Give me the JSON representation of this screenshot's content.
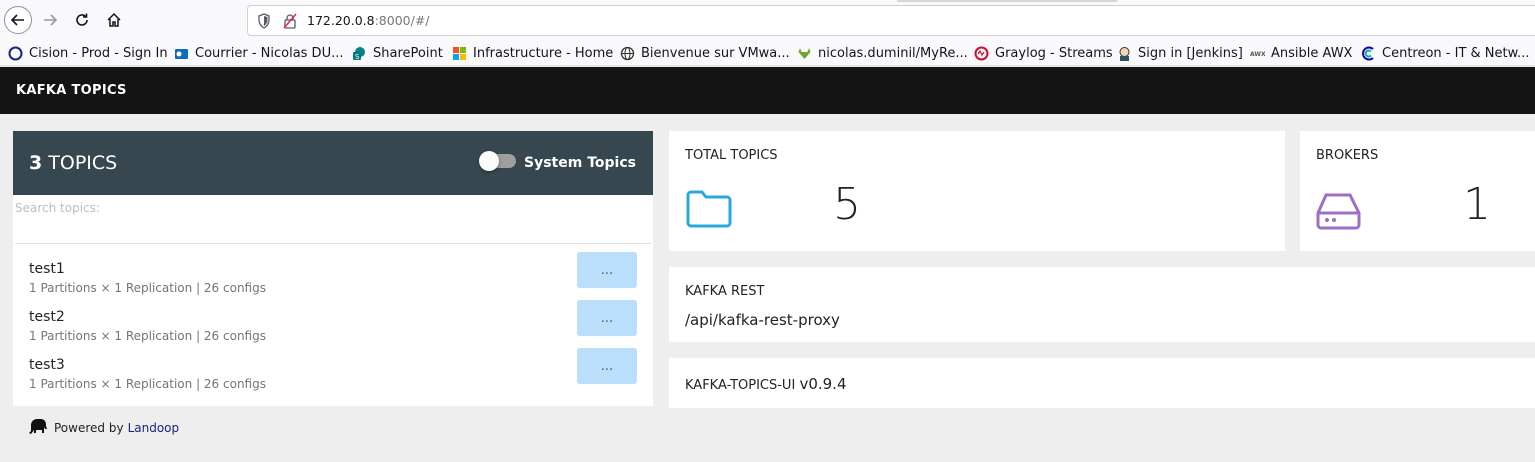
{
  "browser": {
    "url_host": "172.20.0.8",
    "url_rest": ":8000/#/",
    "bookmarks": [
      {
        "label": "Cision - Prod - Sign In",
        "icon": "cision-icon"
      },
      {
        "label": "Courrier - Nicolas DU...",
        "icon": "outlook-icon"
      },
      {
        "label": "SharePoint",
        "icon": "sharepoint-icon"
      },
      {
        "label": "Infrastructure - Home",
        "icon": "windows-icon"
      },
      {
        "label": "Bienvenue sur VMwa...",
        "icon": "globe-icon"
      },
      {
        "label": "nicolas.duminil/MyRe...",
        "icon": "gitlab-icon"
      },
      {
        "label": "Graylog - Streams",
        "icon": "graylog-icon"
      },
      {
        "label": "Sign in [Jenkins]",
        "icon": "jenkins-icon"
      },
      {
        "label": "Ansible AWX",
        "icon": "awx-icon"
      },
      {
        "label": "Centreon - IT & Netw...",
        "icon": "centreon-icon"
      }
    ]
  },
  "header": {
    "title": "KAFKA TOPICS"
  },
  "topics": {
    "count": "3",
    "count_label": "TOPICS",
    "system_toggle_label": "System Topics",
    "search_placeholder": "Search topics:",
    "items": [
      {
        "name": "test1",
        "meta": "1 Partitions × 1 Replication | 26 configs",
        "button": "..."
      },
      {
        "name": "test2",
        "meta": "1 Partitions × 1 Replication | 26 configs",
        "button": "..."
      },
      {
        "name": "test3",
        "meta": "1 Partitions × 1 Replication | 26 configs",
        "button": "..."
      }
    ]
  },
  "powered": {
    "text": "Powered by",
    "link": "Landoop"
  },
  "cards": {
    "total_topics": {
      "label": "TOTAL TOPICS",
      "value": "5",
      "icon": "folder-icon",
      "icon_color": "#29a8e0"
    },
    "brokers": {
      "label": "BROKERS",
      "value": "1",
      "icon": "hard-drive-icon",
      "icon_color": "#9c6fc4"
    },
    "kafka_rest": {
      "label": "KAFKA REST",
      "value": "/api/kafka-rest-proxy"
    },
    "version": {
      "label": "KAFKA-TOPICS-UI",
      "value": "v0.9.4"
    }
  }
}
